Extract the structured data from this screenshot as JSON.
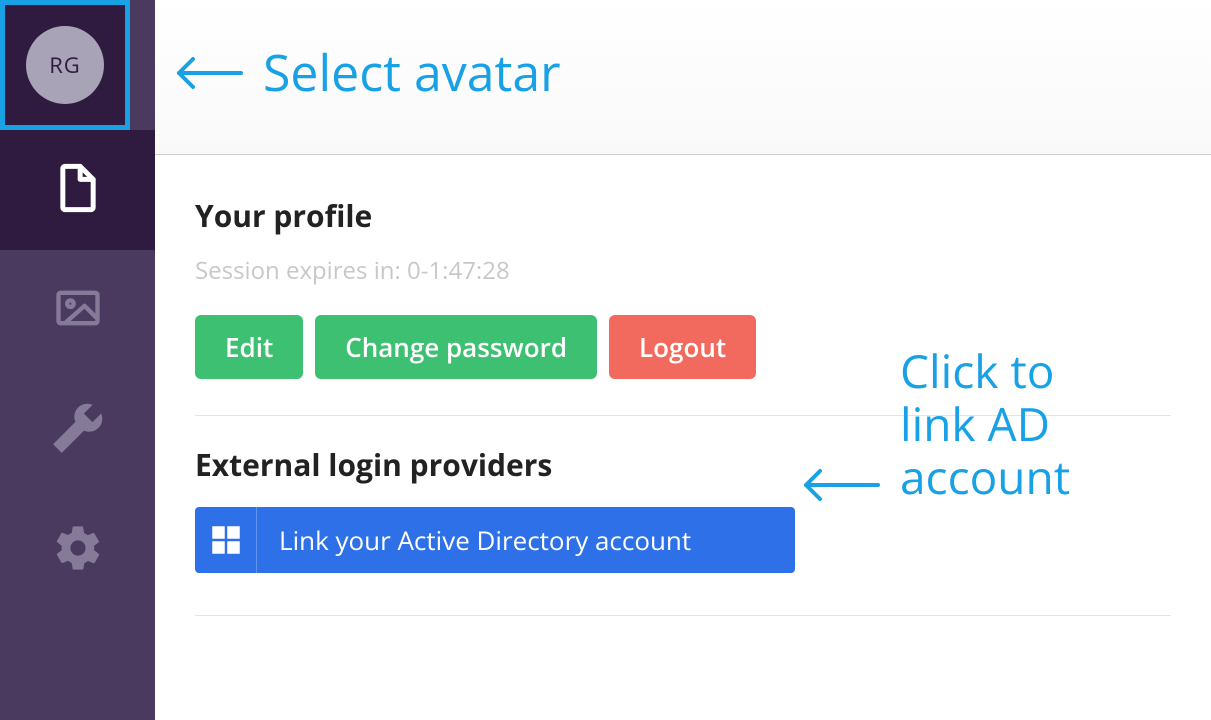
{
  "avatar_initials": "RG",
  "colors": {
    "sidebar_bg": "#4a3a60",
    "sidebar_dark": "#2e1b3f",
    "highlight": "#19a1e6",
    "green": "#3ec072",
    "red": "#f26a5e",
    "blue": "#2d70e8"
  },
  "nav_icons": [
    "file-icon",
    "image-icon",
    "wrench-icon",
    "gear-icon"
  ],
  "profile": {
    "heading": "Your profile",
    "session_text": "Session expires in: 0-1:47:28",
    "edit_label": "Edit",
    "change_pw_label": "Change password",
    "logout_label": "Logout"
  },
  "external": {
    "heading": "External login providers",
    "link_ad_label": "Link your Active Directory account"
  },
  "annotations": {
    "select_avatar": "Select avatar",
    "link_ad": "Click to\nlink AD\naccount"
  }
}
